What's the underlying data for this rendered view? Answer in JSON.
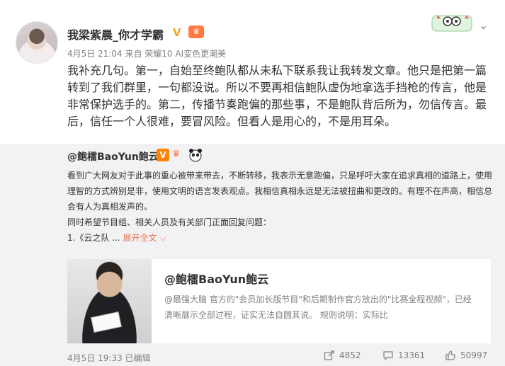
{
  "post": {
    "username": "我梁紫晨_你才学霸",
    "meta": "4月5日 21:04 来自 荣耀10 AI变色更潮美",
    "text": "我补充几句。第一，自始至终鲍队都从未私下联系我让我转发文章。他只是把第一篇转到了我们群里，一句都没说。所以不要再相信鲍队虚伪地拿选手挡枪的传言，他是非常保护选手的。第二，传播节奏跑偏的那些事，不是鲍队背后所为，勿信传言。最后，信任一个人很难，要冒风险。但看人是用心的，不是用耳朵。"
  },
  "repost": {
    "username": "@鲍檑BaoYun鲍云",
    "paragraph1": "看到广大网友对于此事的重心被带来带去，不断转移，我表示无意跑偏，只是呼吁大家在追求真相的道路上，使用理智的方式辨别是非，使用文明的语言发表观点。我相信真相永远是无法被扭曲和更改的。有理不在声高，相信总会有人为真相发声的。",
    "paragraph2": "同时希望节目组、相关人员及有关部门正面回复问题：",
    "item_prefix": "1.《云之队 ...",
    "expand_label": "展开全文 ⌵",
    "card": {
      "title": "@鲍檑BaoYun鲍云",
      "desc": "@最强大脑 官方的\"会员加长版节目\"和后期制作官方放出的\"比赛全程视频\"，已经清晰展示全部过程，证实无法自圆其说。 规则说明：实际比"
    },
    "meta": "4月5日 19:33 已编辑",
    "share_count": "4852",
    "comment_count": "13361",
    "like_count": "50997"
  },
  "icons": {
    "more": "chevron-down-icon",
    "share": "share-icon",
    "comment": "comment-icon",
    "like": "thumbs-up-icon"
  },
  "colors": {
    "expand": "#eb7350",
    "verified": "#f5a623",
    "repost_bg": "#f2f2f5"
  }
}
